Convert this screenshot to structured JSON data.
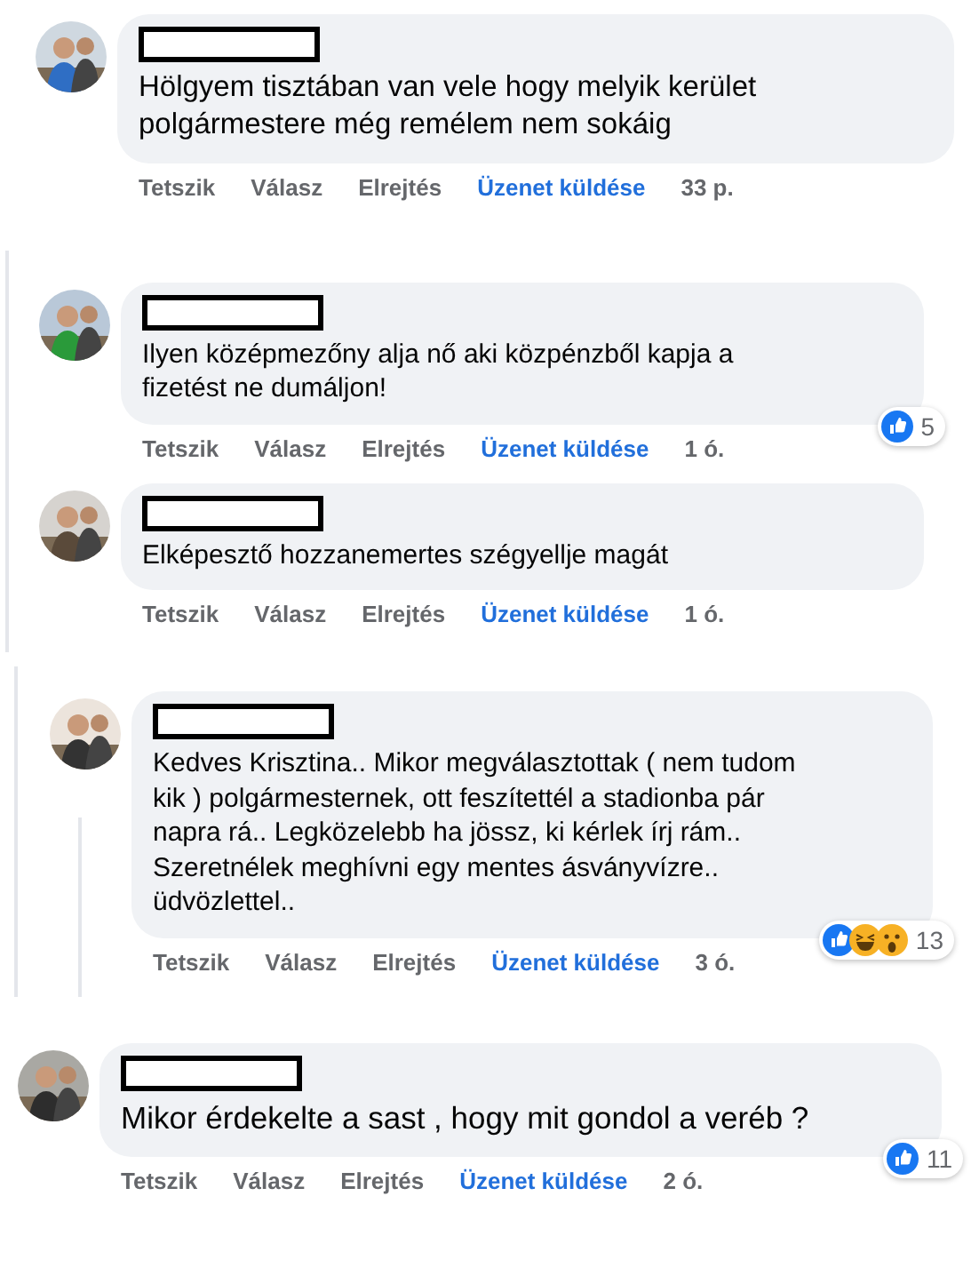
{
  "segments": [
    {
      "kind": "plain",
      "comments": [
        {
          "text": "Hölgyem tisztában van vele hogy melyik kerület polgármestere még remélem nem sokáig",
          "actions": [
            {
              "label": "Tetszik",
              "kind": "plain"
            },
            {
              "label": "Válasz",
              "kind": "plain"
            },
            {
              "label": "Elrejtés",
              "kind": "plain"
            },
            {
              "label": "Üzenet küldése",
              "kind": "link"
            }
          ],
          "time": "33 p."
        }
      ]
    },
    {
      "kind": "nested",
      "comments": [
        {
          "text": "Ilyen középmezőny alja nő aki közpénzből kapja a fizetést ne dumáljon!",
          "actions": [
            {
              "label": "Tetszik",
              "kind": "plain"
            },
            {
              "label": "Válasz",
              "kind": "plain"
            },
            {
              "label": "Elrejtés",
              "kind": "plain"
            },
            {
              "label": "Üzenet küldése",
              "kind": "link"
            }
          ],
          "time": "1 ó.",
          "reactions": {
            "icons": [
              {
                "kind": "like"
              }
            ],
            "count": "5"
          }
        },
        {
          "text": "Elképesztő hozzanemertes szégyellje magát",
          "actions": [
            {
              "label": "Tetszik",
              "kind": "plain"
            },
            {
              "label": "Válasz",
              "kind": "plain"
            },
            {
              "label": "Elrejtés",
              "kind": "plain"
            },
            {
              "label": "Üzenet küldése",
              "kind": "link"
            }
          ],
          "time": "1 ó."
        }
      ]
    },
    {
      "kind": "thread",
      "comments": [
        {
          "text": "Kedves Krisztina.. Mikor megválasztottak ( nem tudom kik ) polgármesternek, ott feszítettél a stadionba pár napra rá.. Legközelebb ha jössz, ki kérlek írj rám.. Szeretnélek meghívni egy mentes ásványvízre.. üdvözlettel..",
          "actions": [
            {
              "label": "Tetszik",
              "kind": "plain"
            },
            {
              "label": "Válasz",
              "kind": "plain"
            },
            {
              "label": "Elrejtés",
              "kind": "plain"
            },
            {
              "label": "Üzenet küldése",
              "kind": "link"
            }
          ],
          "time": "3 ó.",
          "reactions": {
            "icons": [
              {
                "kind": "like"
              },
              {
                "kind": "haha"
              },
              {
                "kind": "wow"
              }
            ],
            "count": "13"
          }
        }
      ]
    },
    {
      "kind": "large",
      "comments": [
        {
          "text": "Mikor érdekelte a sast , hogy mit gondol a veréb ?",
          "actions": [
            {
              "label": "Tetszik",
              "kind": "plain"
            },
            {
              "label": "Válasz",
              "kind": "plain"
            },
            {
              "label": "Elrejtés",
              "kind": "plain"
            },
            {
              "label": "Üzenet küldése",
              "kind": "link"
            }
          ],
          "time": "2 ó.",
          "reactions": {
            "icons": [
              {
                "kind": "like"
              }
            ],
            "count": "11"
          }
        }
      ]
    }
  ]
}
